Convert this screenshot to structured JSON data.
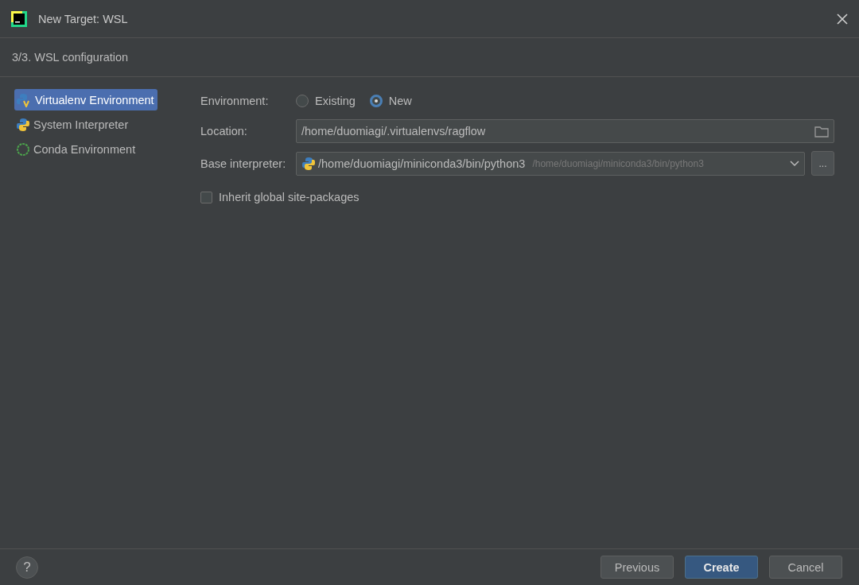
{
  "window": {
    "title": "New Target: WSL"
  },
  "step": "3/3. WSL configuration",
  "sidebar": {
    "items": [
      {
        "label": "Virtualenv Environment",
        "kind": "virtualenv",
        "selected": true
      },
      {
        "label": "System Interpreter",
        "kind": "python",
        "selected": false
      },
      {
        "label": "Conda Environment",
        "kind": "conda",
        "selected": false
      }
    ]
  },
  "form": {
    "environment": {
      "label": "Environment:",
      "options": [
        {
          "label": "Existing",
          "selected": false
        },
        {
          "label": "New",
          "selected": true
        }
      ]
    },
    "location": {
      "label": "Location:",
      "value": "/home/duomiagi/.virtualenvs/ragflow"
    },
    "base_interpreter": {
      "label": "Base interpreter:",
      "value": "/home/duomiagi/miniconda3/bin/python3",
      "hint": "/home/duomiagi/miniconda3/bin/python3",
      "browse": "..."
    },
    "inherit": {
      "label": "Inherit global site-packages",
      "checked": false
    }
  },
  "footer": {
    "help": "?",
    "buttons": [
      {
        "label": "Previous",
        "kind": "default"
      },
      {
        "label": "Create",
        "kind": "primary"
      },
      {
        "label": "Cancel",
        "kind": "default"
      }
    ]
  }
}
